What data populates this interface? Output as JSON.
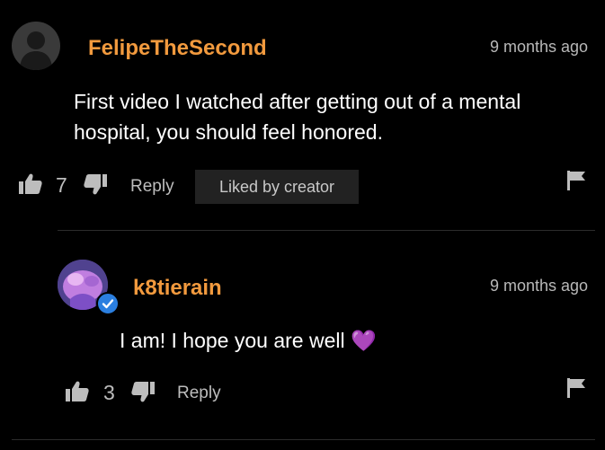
{
  "comments": [
    {
      "username": "FelipeTheSecond",
      "timestamp": "9 months ago",
      "text_lines": [
        "First video I watched after getting out of a mental",
        "hospital, you should feel honored."
      ],
      "likes": "7",
      "reply_label": "Reply",
      "badge": "Liked by creator",
      "avatar_icon": "default-user-avatar-icon"
    },
    {
      "username": "k8tierain",
      "timestamp": "9 months ago",
      "text": "I am! I hope you are well",
      "emoji": "💜",
      "likes": "3",
      "reply_label": "Reply",
      "verified_icon": "verified-check-icon"
    }
  ],
  "colors": {
    "username": "#f29a3e",
    "background": "#000000",
    "badge_bg": "#222222",
    "verified": "#2b7fe0"
  }
}
